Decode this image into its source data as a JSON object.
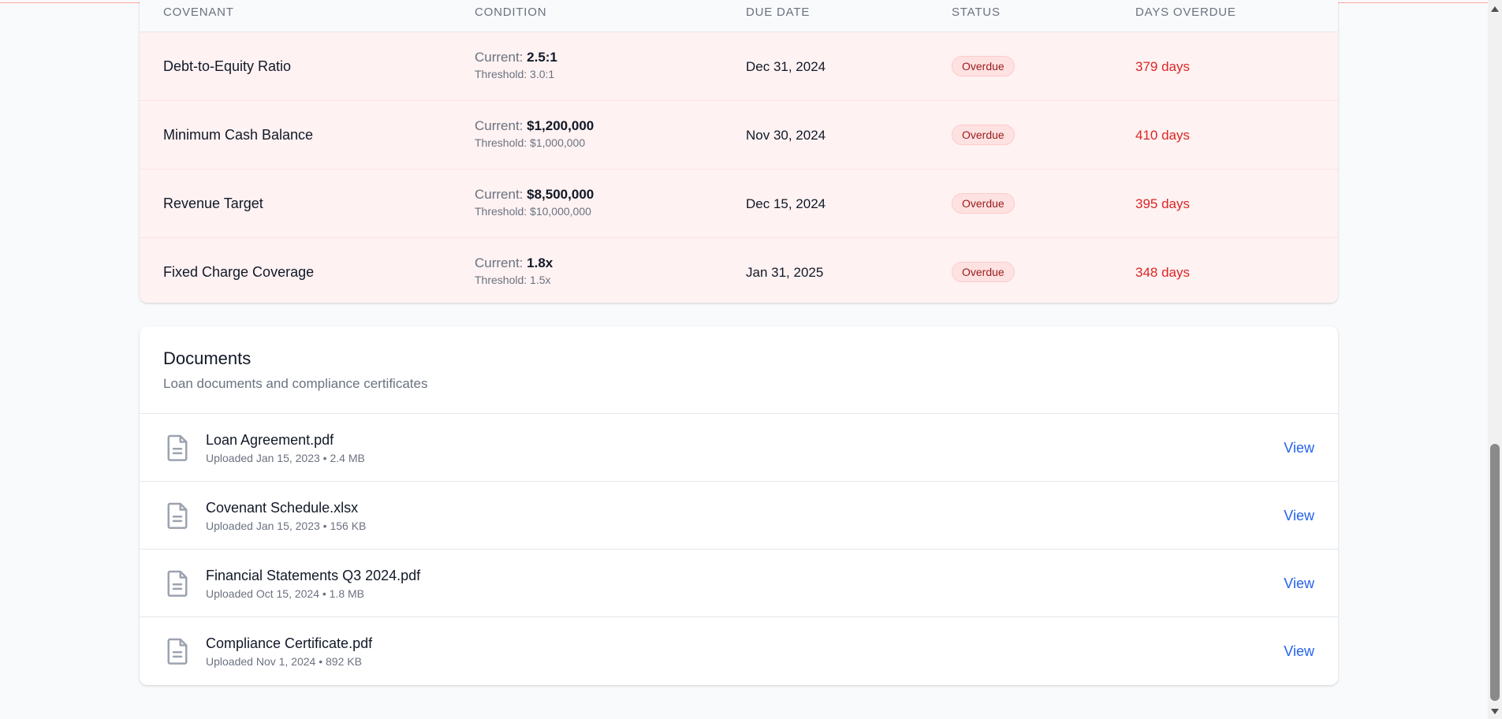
{
  "covenants": {
    "headers": {
      "covenant": "COVENANT",
      "condition": "CONDITION",
      "due_date": "DUE DATE",
      "status": "STATUS",
      "days_overdue": "DAYS OVERDUE"
    },
    "rows": [
      {
        "name": "Debt-to-Equity Ratio",
        "current_label": "Current: ",
        "current": "2.5:1",
        "threshold": "Threshold: 3.0:1",
        "due": "Dec 31, 2024",
        "status": "Overdue",
        "days": "379 days"
      },
      {
        "name": "Minimum Cash Balance",
        "current_label": "Current: ",
        "current": "$1,200,000",
        "threshold": "Threshold: $1,000,000",
        "due": "Nov 30, 2024",
        "status": "Overdue",
        "days": "410 days"
      },
      {
        "name": "Revenue Target",
        "current_label": "Current: ",
        "current": "$8,500,000",
        "threshold": "Threshold: $10,000,000",
        "due": "Dec 15, 2024",
        "status": "Overdue",
        "days": "395 days"
      },
      {
        "name": "Fixed Charge Coverage",
        "current_label": "Current: ",
        "current": "1.8x",
        "threshold": "Threshold: 1.5x",
        "due": "Jan 31, 2025",
        "status": "Overdue",
        "days": "348 days"
      }
    ]
  },
  "documents": {
    "title": "Documents",
    "subtitle": "Loan documents and compliance certificates",
    "icon": "file-text-icon",
    "items": [
      {
        "name": "Loan Agreement.pdf",
        "meta": "Uploaded Jan 15, 2023 • 2.4 MB",
        "action": "View"
      },
      {
        "name": "Covenant Schedule.xlsx",
        "meta": "Uploaded Jan 15, 2023 • 156 KB",
        "action": "View"
      },
      {
        "name": "Financial Statements Q3 2024.pdf",
        "meta": "Uploaded Oct 15, 2024 • 1.8 MB",
        "action": "View"
      },
      {
        "name": "Compliance Certificate.pdf",
        "meta": "Uploaded Nov 1, 2024 • 892 KB",
        "action": "View"
      }
    ]
  },
  "colors": {
    "overdue_row_bg": "#fef2f2",
    "overdue_text": "#dc2626",
    "badge_bg": "#fee2e2",
    "link": "#2563eb"
  }
}
